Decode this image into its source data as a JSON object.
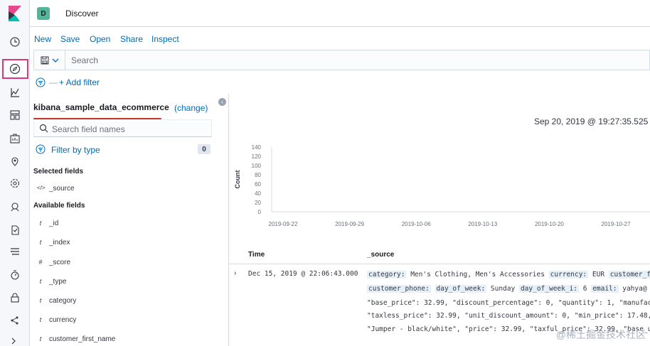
{
  "header": {
    "space_initial": "D",
    "title": "Discover"
  },
  "menu": {
    "new": "New",
    "save": "Save",
    "open": "Open",
    "share": "Share",
    "inspect": "Inspect"
  },
  "query": {
    "placeholder": "Search"
  },
  "filters": {
    "add_label": "+ Add filter",
    "dash": "—"
  },
  "sidebar": {
    "index_pattern": "kibana_sample_data_ecommerce",
    "change_label": "(change)",
    "search_placeholder": "Search field names",
    "filter_by_type": "Filter by type",
    "filter_count": "0",
    "selected_title": "Selected fields",
    "selected_fields": [
      {
        "type": "</>",
        "name": "_source"
      }
    ],
    "available_title": "Available fields",
    "available_fields": [
      {
        "type": "t",
        "name": "_id"
      },
      {
        "type": "t",
        "name": "_index"
      },
      {
        "type": "#",
        "name": "_score"
      },
      {
        "type": "t",
        "name": "_type"
      },
      {
        "type": "t",
        "name": "category"
      },
      {
        "type": "t",
        "name": "currency"
      },
      {
        "type": "t",
        "name": "customer_first_name"
      }
    ]
  },
  "main": {
    "date_range": "Sep 20, 2019 @ 19:27:35.525 -",
    "col_time": "Time",
    "col_source": "_source",
    "row": {
      "time": "Dec 15, 2019 @ 22:06:43.000",
      "line1": [
        {
          "k": "category:",
          "v": " Men's Clothing, Men's Accessories "
        },
        {
          "k": "currency:",
          "v": " EUR "
        },
        {
          "k": "customer_f",
          "v": ""
        }
      ],
      "line2": [
        {
          "k": "customer_phone:",
          "v": "  "
        },
        {
          "k": "day_of_week:",
          "v": " Sunday "
        },
        {
          "k": "day_of_week_i:",
          "v": " 6 "
        },
        {
          "k": "email:",
          "v": " yahya@"
        }
      ],
      "line3": "\"base_price\": 32.99, \"discount_percentage\": 0, \"quantity\": 1, \"manufac",
      "line4": "\"taxless_price\": 32.99, \"unit_discount_amount\": 0, \"min_price\": 17.48,",
      "line5": "\"Jumper - black/white\", \"price\": 32.99, \"taxful_price\": 32.99, \"base_u"
    },
    "watermark": "@稀土掘金技术社区"
  },
  "chart_data": {
    "type": "bar",
    "ylabel": "Count",
    "xlabel": "",
    "yticks": [
      0,
      20,
      40,
      60,
      80,
      100,
      120,
      140
    ],
    "ylim": [
      0,
      140
    ],
    "x_ticks": [
      "2019-09-22",
      "2019-09-29",
      "2019-10-06",
      "2019-10-13",
      "2019-10-20",
      "2019-10-27"
    ],
    "values": [],
    "grid": false
  }
}
